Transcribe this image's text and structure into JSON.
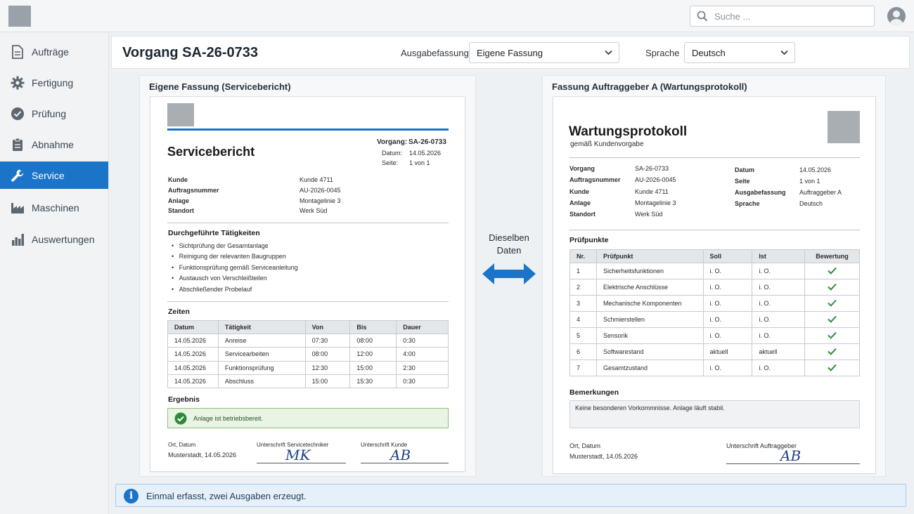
{
  "topbar": {
    "search_placeholder": "Suche ..."
  },
  "sidebar": {
    "items": [
      {
        "label": "Aufträge",
        "icon": "document-icon"
      },
      {
        "label": "Fertigung",
        "icon": "gear-icon"
      },
      {
        "label": "Prüfung",
        "icon": "check-circle-icon"
      },
      {
        "label": "Abnahme",
        "icon": "clipboard-icon"
      },
      {
        "label": "Service",
        "icon": "wrench-icon",
        "active": true
      },
      {
        "label": "Maschinen",
        "icon": "factory-icon"
      },
      {
        "label": "Auswertungen",
        "icon": "bar-chart-icon"
      }
    ]
  },
  "header": {
    "title": "Vorgang SA-26-0733",
    "edition_label": "Ausgabefassung",
    "edition_value": "Eigene Fassung",
    "language_label": "Sprache",
    "language_value": "Deutsch"
  },
  "left": {
    "panel_title": "Eigene Fassung (Servicebericht)",
    "doc_title": "Servicebericht",
    "vorgang_label": "Vorgang:",
    "vorgang_value": "SA-26-0733",
    "datum_label": "Datum:",
    "datum_value": "14.05.2026",
    "seite_label": "Seite:",
    "seite_value": "1 von 1",
    "fields": [
      {
        "label": "Kunde",
        "value": "Kunde 4711"
      },
      {
        "label": "Auftragsnummer",
        "value": "AU-2026-0045"
      },
      {
        "label": "Anlage",
        "value": "Montagelinie 3"
      },
      {
        "label": "Standort",
        "value": "Werk Süd"
      }
    ],
    "activities_heading": "Durchgeführte Tätigkeiten",
    "activities": [
      "Sichtprüfung der Gesamtanlage",
      "Reinigung der relevanten Baugruppen",
      "Funktionsprüfung gemäß Serviceanleitung",
      "Austausch von Verschleißteilen",
      "Abschließender Probelauf"
    ],
    "times_heading": "Zeiten",
    "times_columns": [
      "Datum",
      "Tätigkeit",
      "Von",
      "Bis",
      "Dauer"
    ],
    "times_rows": [
      [
        "14.05.2026",
        "Anreise",
        "07:30",
        "08:00",
        "0:30"
      ],
      [
        "14.05.2026",
        "Servicearbeiten",
        "08:00",
        "12:00",
        "4:00"
      ],
      [
        "14.05.2026",
        "Funktionsprüfung",
        "12:30",
        "15:00",
        "2:30"
      ],
      [
        "14.05.2026",
        "Abschluss",
        "15:00",
        "15:30",
        "0:30"
      ]
    ],
    "result_heading": "Ergebnis",
    "result_text": "Anlage ist betriebsbereit.",
    "place_date_label": "Ort, Datum",
    "place_date_value": "Musterstadt, 14.05.2026",
    "sig_tech_label": "Unterschrift Servicetechniker",
    "sig_tech_value": "MK",
    "sig_customer_label": "Unterschrift Kunde",
    "sig_customer_value": "AB"
  },
  "middle": {
    "line1": "Dieselben",
    "line2": "Daten"
  },
  "right": {
    "panel_title": "Fassung Auftraggeber A (Wartungsprotokoll)",
    "doc_title": "Wartungsprotokoll",
    "doc_subtitle": "gemäß Kundenvorgabe",
    "fields_left": [
      {
        "label": "Vorgang",
        "value": "SA-26-0733"
      },
      {
        "label": "Auftragsnummer",
        "value": "AU-2026-0045"
      },
      {
        "label": "Kunde",
        "value": "Kunde 4711"
      },
      {
        "label": "Anlage",
        "value": "Montagelinie 3"
      },
      {
        "label": "Standort",
        "value": "Werk Süd"
      }
    ],
    "fields_right": [
      {
        "label": "Datum",
        "value": "14.05.2026"
      },
      {
        "label": "Seite",
        "value": "1 von 1"
      },
      {
        "label": "Ausgabefassung",
        "value": "Auftraggeber A"
      },
      {
        "label": "Sprache",
        "value": "Deutsch"
      }
    ],
    "checks_heading": "Prüfpunkte",
    "checks_columns": [
      "Nr.",
      "Prüfpunkt",
      "Soll",
      "Ist",
      "Bewertung"
    ],
    "checks_rows": [
      [
        "1",
        "Sicherheitsfunktionen",
        "i. O.",
        "i. O."
      ],
      [
        "2",
        "Elektrische Anschlüsse",
        "i. O.",
        "i. O."
      ],
      [
        "3",
        "Mechanische Komponenten",
        "i. O.",
        "i. O."
      ],
      [
        "4",
        "Schmierstellen",
        "i. O.",
        "i. O."
      ],
      [
        "5",
        "Sensorik",
        "i. O.",
        "i. O."
      ],
      [
        "6",
        "Softwarestand",
        "aktuell",
        "aktuell"
      ],
      [
        "7",
        "Gesamtzustand",
        "i. O.",
        "i. O."
      ]
    ],
    "remarks_heading": "Bemerkungen",
    "remarks_text": "Keine besonderen Vorkommnisse. Anlage läuft stabil.",
    "place_date_label": "Ort, Datum",
    "place_date_value": "Musterstadt, 14.05.2026",
    "sig_label": "Unterschrift Auftraggeber",
    "sig_value": "AB"
  },
  "footer": {
    "info_text": "Einmal erfasst, zwei Ausgaben erzeugt."
  },
  "colors": {
    "accent": "#1b74c8",
    "check": "#2e8b3a",
    "result_bg": "#e9f4e4"
  }
}
